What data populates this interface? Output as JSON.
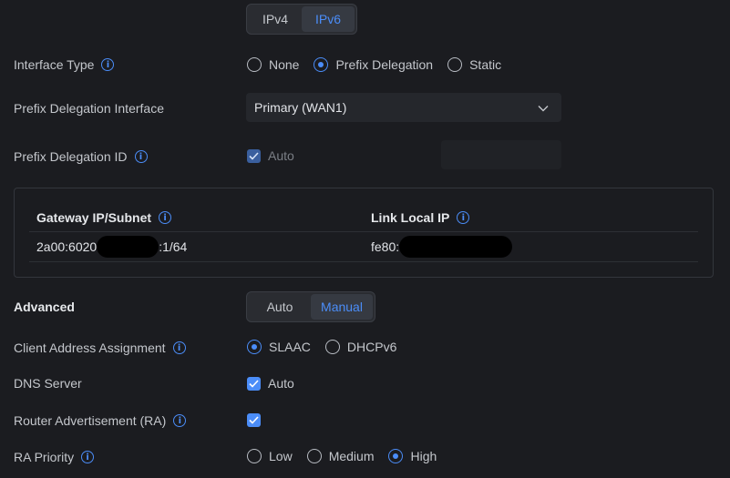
{
  "ip_version_tabs": [
    {
      "label": "IPv4",
      "active": false
    },
    {
      "label": "IPv6",
      "active": true
    }
  ],
  "interface_type": {
    "label": "Interface Type",
    "options": [
      {
        "label": "None",
        "selected": false
      },
      {
        "label": "Prefix Delegation",
        "selected": true
      },
      {
        "label": "Static",
        "selected": false
      }
    ]
  },
  "prefix_delegation_interface": {
    "label": "Prefix Delegation Interface",
    "value": "Primary (WAN1)"
  },
  "prefix_delegation_id": {
    "label": "Prefix Delegation ID",
    "auto_label": "Auto",
    "auto_checked": true,
    "value": ""
  },
  "info_panel": {
    "gateway_header": "Gateway IP/Subnet",
    "gateway_prefix": "2a00:6020",
    "gateway_suffix": ":1/64",
    "link_local_header": "Link Local IP",
    "link_local_prefix": "fe80::"
  },
  "advanced": {
    "label": "Advanced",
    "tabs": [
      {
        "label": "Auto",
        "active": false
      },
      {
        "label": "Manual",
        "active": true
      }
    ]
  },
  "client_address_assignment": {
    "label": "Client Address Assignment",
    "options": [
      {
        "label": "SLAAC",
        "selected": true
      },
      {
        "label": "DHCPv6",
        "selected": false
      }
    ]
  },
  "dns_server": {
    "label": "DNS Server",
    "auto_label": "Auto",
    "auto_checked": true
  },
  "router_advertisement": {
    "label": "Router Advertisement (RA)",
    "checked": true
  },
  "ra_priority": {
    "label": "RA Priority",
    "options": [
      {
        "label": "Low",
        "selected": false
      },
      {
        "label": "Medium",
        "selected": false
      },
      {
        "label": "High",
        "selected": true
      }
    ]
  },
  "colors": {
    "background": "#1b1c20",
    "accent": "#4b8df8",
    "panel_border": "#33363c"
  }
}
